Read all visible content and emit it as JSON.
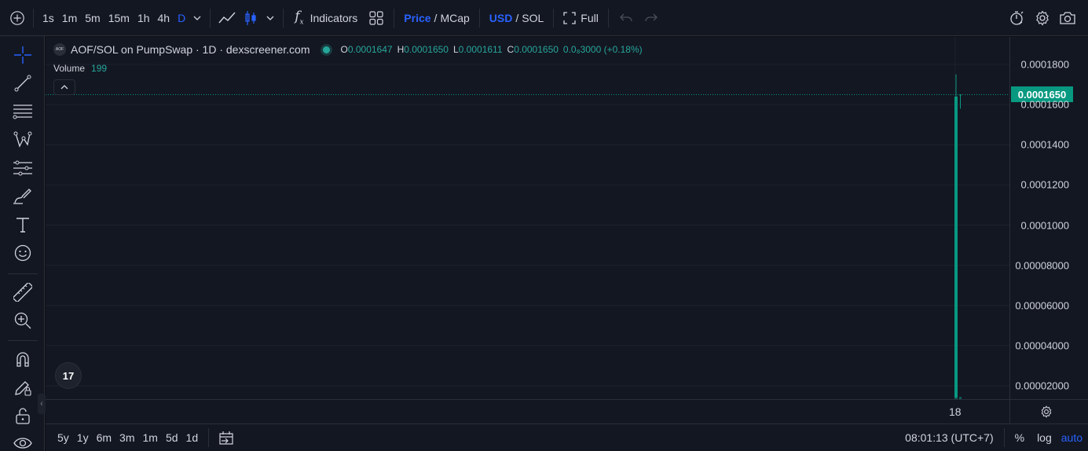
{
  "toolbar": {
    "intervals": [
      "1s",
      "1m",
      "5m",
      "15m",
      "1h",
      "4h",
      "D"
    ],
    "active_interval": "D",
    "indicators_label": "Indicators",
    "price_label": "Price",
    "mcap_label": "MCap",
    "usd_label": "USD",
    "sol_label": "SOL",
    "full_label": "Full",
    "slash": "/"
  },
  "legend": {
    "title": "AOF/SOL on PumpSwap · 1D · dexscreener.com",
    "symbol_badge": "AOF",
    "o_key": "O",
    "o_val": "0.0001647",
    "h_key": "H",
    "h_val": "0.0001650",
    "l_key": "L",
    "l_val": "0.0001611",
    "c_key": "C",
    "c_val": "0.0001650",
    "change": "0.0₈3000 (+0.18%)",
    "volume_label": "Volume",
    "volume_value": "199"
  },
  "price_axis": {
    "labels": [
      "0.0001800",
      "0.0001600",
      "0.0001400",
      "0.0001200",
      "0.0001000",
      "0.00008000",
      "0.00006000",
      "0.00004000",
      "0.00002000"
    ],
    "current_price": "0.0001650"
  },
  "time_axis": {
    "label": "18"
  },
  "bottombar": {
    "ranges": [
      "5y",
      "1y",
      "6m",
      "3m",
      "1m",
      "5d",
      "1d"
    ],
    "clock": "08:01:13 (UTC+7)",
    "percent_label": "%",
    "log_label": "log",
    "auto_label": "auto"
  },
  "logo_text": "17",
  "colors": {
    "up": "#089981",
    "accent": "#2962ff",
    "background": "#131722"
  },
  "chart_data": {
    "type": "candlestick",
    "title": "AOF/SOL on PumpSwap · 1D · dexscreener.com",
    "x": [
      "18"
    ],
    "open": [
      0.0001647
    ],
    "high": [
      0.000165
    ],
    "low": [
      0.0001611
    ],
    "close": [
      0.000165
    ],
    "prior_candle": {
      "open": 0.0,
      "high": 0.000175,
      "low": 0.0,
      "close": 0.000164
    },
    "volume": [
      199
    ],
    "ylim": [
      0,
      0.000185
    ],
    "grid": true
  }
}
